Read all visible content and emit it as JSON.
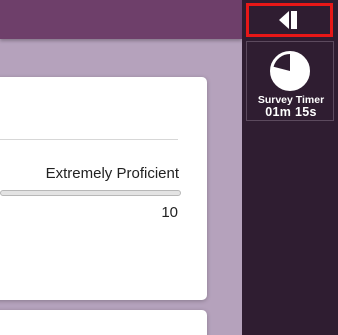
{
  "question": {
    "scale_max_label": "Extremely Proficient",
    "scale_max_value": "10"
  },
  "sidebar": {
    "collapse_icon": "collapse-left-icon",
    "timer": {
      "icon": "pie-timer-icon",
      "label": "Survey Timer",
      "value": "01m 15s",
      "elapsed_fraction": 0.21
    }
  },
  "colors": {
    "topbar": "#6e3f6a",
    "background": "#b5a2bc",
    "sidebar": "#2f1d31",
    "highlight": "#e81717"
  }
}
